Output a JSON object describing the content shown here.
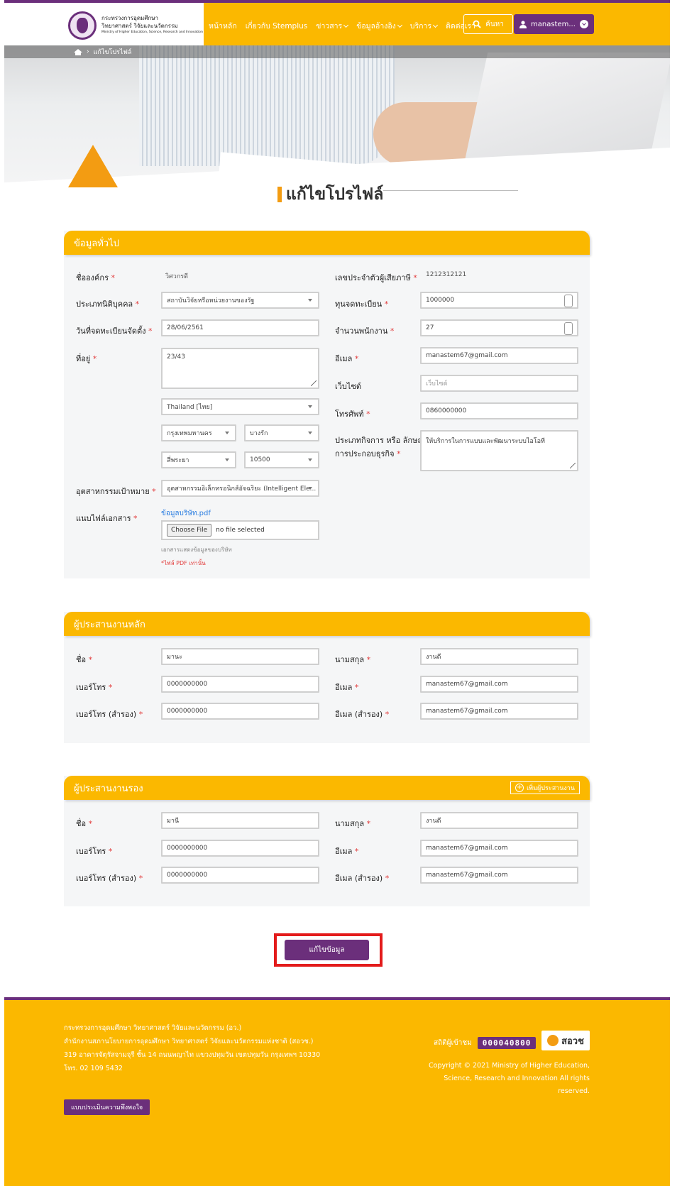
{
  "header": {
    "logo_line1": "กระทรวงการอุดมศึกษา",
    "logo_line2": "วิทยาศาสตร์ วิจัยและนวัตกรรม",
    "logo_line3": "Ministry of Higher Education, Science, Research and Innovation",
    "nav": [
      "หน้าหลัก",
      "เกี่ยวกับ Stemplus",
      "ข่าวสาร",
      "ข้อมูลอ้างอิง",
      "บริการ",
      "ติดต่อเรา"
    ],
    "search_label": "ค้นหา",
    "user_label": "manastem..."
  },
  "breadcrumb": {
    "current": "แก้ไขโปรไฟล์"
  },
  "page_title": "แก้ไขโปรไฟล์",
  "general": {
    "heading": "ข้อมูลทั่วไป",
    "org_name_label": "ชื่อองค์กร",
    "org_name_value": "วิศวกรดี",
    "tax_id_label": "เลขประจำตัวผู้เสียภาษี",
    "tax_id_value": "1212312121",
    "entity_type_label": "ประเภทนิติบุคคล",
    "entity_type_value": "สถาบันวิจัยหรือหน่วยงานของรัฐ",
    "capital_label": "ทุนจดทะเบียน",
    "capital_value": "1000000",
    "reg_date_label": "วันที่จดทะเบียนจัดตั้ง",
    "reg_date_value": "28/06/2561",
    "employees_label": "จำนวนพนักงาน",
    "employees_value": "27",
    "address_label": "ที่อยู่",
    "address_value": "23/43",
    "email_label": "อีเมล",
    "email_value": "manastem67@gmail.com",
    "website_label": "เว็บไซต์",
    "website_placeholder": "เว็บไซต์",
    "country_value": "Thailand [ไทย]",
    "phone_label": "โทรศัพท์",
    "phone_value": "0860000000",
    "province_value": "กรุงเทพมหานคร",
    "district_value": "บางรัก",
    "business_label_1": "ประเภทกิจการ หรือ ลักษณะ",
    "business_label_2": "การประกอบธุรกิจ",
    "business_value": "ให้บริการในการแบบและพัฒนาระบบไอโอที",
    "subdistrict_value": "สี่พระยา",
    "postcode_value": "10500",
    "industry_label": "อุตสาหกรรมเป้าหมาย",
    "industry_value": "อุตสาหกรรมอิเล็กทรอนิกส์อัจฉริยะ (Intelligent Ele...",
    "file_label": "แนบไฟล์เอกสาร",
    "file_link": "ข้อมูลบริษัท.pdf",
    "choose_file": "Choose File",
    "no_file": "no file selected",
    "file_hint": "เอกสารแสดงข้อมูลของบริษัท",
    "file_note": "*ไฟล์ PDF เท่านั้น"
  },
  "primary": {
    "heading": "ผู้ประสานงานหลัก",
    "first_label": "ชื่อ",
    "first_value": "มานะ",
    "last_label": "นามสกุล",
    "last_value": "งานดี",
    "phone_label": "เบอร์โทร",
    "phone_value": "0000000000",
    "email_label": "อีเมล",
    "email_value": "manastem67@gmail.com",
    "phone2_label": "เบอร์โทร (สำรอง)",
    "phone2_value": "0000000000",
    "email2_label": "อีเมล (สำรอง)",
    "email2_value": "manastem67@gmail.com"
  },
  "secondary": {
    "heading": "ผู้ประสานงานรอง",
    "add_label": "เพิ่มผู้ประสานงาน",
    "first_label": "ชื่อ",
    "first_value": "มานี",
    "last_label": "นามสกุล",
    "last_value": "งานดี",
    "phone_label": "เบอร์โทร",
    "phone_value": "0000000000",
    "email_label": "อีเมล",
    "email_value": "manastem67@gmail.com",
    "phone2_label": "เบอร์โทร (สำรอง)",
    "phone2_value": "0000000000",
    "email2_label": "อีเมล (สำรอง)",
    "email2_value": "manastem67@gmail.com"
  },
  "submit_label": "แก้ไขข้อมูล",
  "footer": {
    "line1": "กระทรวงการอุดมศึกษา วิทยาศาสตร์ วิจัยและนวัตกรรม (อว.)",
    "line2": "สำนักงานสภานโยบายการอุดมศึกษา วิทยาศาสตร์ วิจัยและนวัตกรรมแห่งชาติ (สอวช.)",
    "line3": "319 อาคารจัตุรัสจามจุรี ชั้น 14 ถนนพญาไท แขวงปทุมวัน เขตปทุมวัน กรุงเทพฯ 10330",
    "line4": "โทร. 02 109 5432",
    "visitor_label": "สถิติผู้เข้าชม",
    "visitor_count": "000040800",
    "brand": "สอวช",
    "copyright_1": "Copyright © 2021 Ministry of Higher Education,",
    "copyright_2": "Science, Research and Innovation All rights",
    "copyright_3": "reserved.",
    "survey_label": "แบบประเมินความพึงพอใจ"
  },
  "colors": {
    "accent": "#fbb800",
    "brand": "#6b2f7b",
    "required": "#e23b3b",
    "highlight": "#e31b1b"
  }
}
